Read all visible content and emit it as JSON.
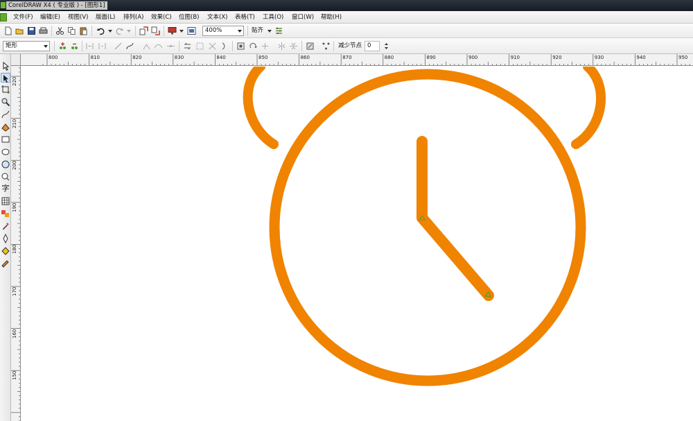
{
  "window": {
    "title": "CorelDRAW X4 ( 专业版 ) - [图形1]"
  },
  "menu": {
    "items": [
      "文件(F)",
      "编辑(E)",
      "视图(V)",
      "版面(L)",
      "排列(A)",
      "效果(C)",
      "位图(B)",
      "文本(X)",
      "表格(T)",
      "工具(O)",
      "窗口(W)",
      "帮助(H)"
    ]
  },
  "standard_toolbar": {
    "zoom": "400%",
    "snap_label": "贴齐",
    "icons": [
      "new-icon",
      "open-icon",
      "save-icon",
      "print-icon",
      "cut-icon",
      "copy-icon",
      "paste-icon",
      "undo-icon",
      "redo-icon",
      "import-icon",
      "export-icon",
      "application-launcher-icon",
      "welcome-screen-icon",
      "options-icon"
    ]
  },
  "property_bar": {
    "object_type": "矩形",
    "reduce_nodes_label": "减少节点",
    "reduce_nodes_value": "0"
  },
  "rulers": {
    "horizontal": [
      "800",
      "810",
      "820",
      "830",
      "840",
      "850",
      "860",
      "870",
      "880",
      "890",
      "900",
      "910",
      "920",
      "930",
      "940",
      "950"
    ],
    "vertical": [
      "220",
      "210",
      "200",
      "190",
      "180",
      "170",
      "160",
      "150"
    ]
  },
  "toolbox": {
    "tools": [
      "pick-tool-icon",
      "shape-tool-icon",
      "crop-tool-icon",
      "zoom-tool-icon",
      "freehand-tool-icon",
      "smart-fill-icon",
      "rectangle-tool-icon",
      "ellipse-tool-icon",
      "polygon-tool-icon",
      "basic-shapes-icon",
      "text-tool-icon",
      "table-tool-icon",
      "interactive-blend-icon",
      "eyedropper-icon",
      "outline-pen-icon",
      "fill-tool-icon",
      "interactive-fill-icon"
    ],
    "text_tool_glyph": "字"
  },
  "drawing": {
    "stroke_color": "#f08300",
    "node_color": "#5a9e20"
  }
}
